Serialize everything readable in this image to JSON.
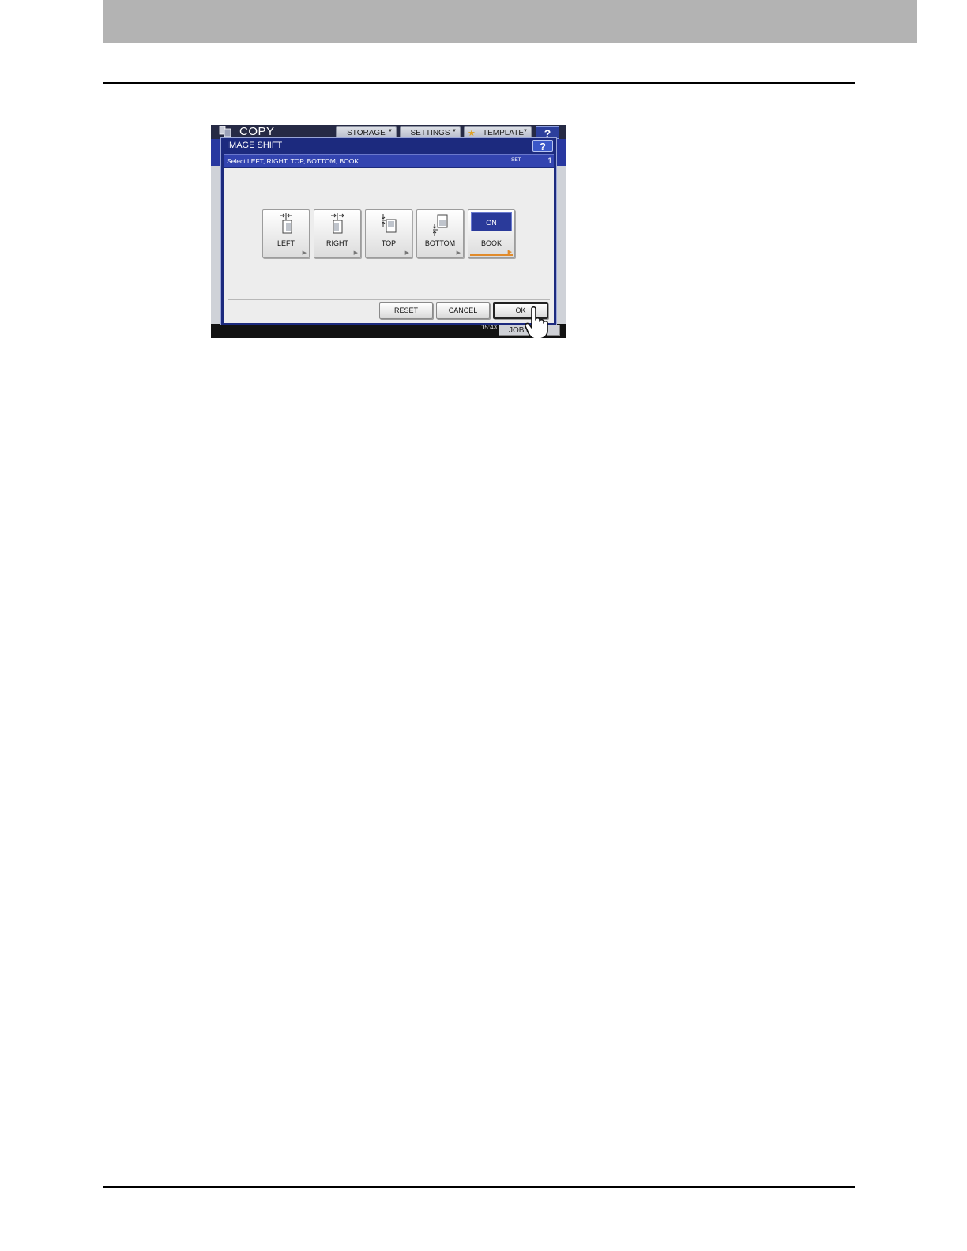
{
  "app": {
    "title": "COPY"
  },
  "tabs": [
    {
      "label": "STORAGE"
    },
    {
      "label": "SETTINGS"
    },
    {
      "label": "TEMPLATE"
    }
  ],
  "help": {
    "label": "?"
  },
  "dialog": {
    "title": "IMAGE SHIFT",
    "help_label": "?",
    "instruction": "Select LEFT, RIGHT, TOP, BOTTOM, BOOK.",
    "set_label": "SET",
    "set_count": "1",
    "options": [
      {
        "label": "LEFT",
        "icon": "shift-left-icon"
      },
      {
        "label": "RIGHT",
        "icon": "shift-right-icon"
      },
      {
        "label": "TOP",
        "icon": "shift-top-icon"
      },
      {
        "label": "BOTTOM",
        "icon": "shift-bottom-icon"
      },
      {
        "label": "BOOK",
        "state": "ON"
      }
    ],
    "buttons": {
      "reset": "RESET",
      "cancel": "CANCEL",
      "ok": "OK"
    }
  },
  "status": {
    "time": "15:43",
    "job_status": "JOB S"
  },
  "colors": {
    "dialog_blue": "#1c2a7e",
    "selected_blue": "#2a3a9a",
    "accent_orange": "#e08a2a"
  }
}
